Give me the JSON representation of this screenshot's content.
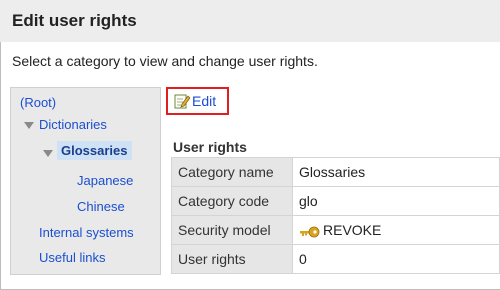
{
  "page": {
    "title": "Edit user rights",
    "description": "Select a category to view and change user rights."
  },
  "tree": {
    "root": "(Root)",
    "dictionaries": "Dictionaries",
    "glossaries": "Glossaries",
    "japanese": "Japanese",
    "chinese": "Chinese",
    "internal_systems": "Internal systems",
    "useful_links": "Useful links"
  },
  "toolbar": {
    "edit_label": "Edit",
    "edit_icon": "edit-icon"
  },
  "user_rights": {
    "section_title": "User rights",
    "rows": [
      {
        "label": "Category name",
        "value": "Glossaries"
      },
      {
        "label": "Category code",
        "value": "glo"
      },
      {
        "label": "Security model",
        "value": "REVOKE",
        "icon": "key-icon"
      },
      {
        "label": "User rights",
        "value": "0"
      }
    ]
  },
  "colors": {
    "link": "#1a4fd0",
    "highlight_border": "#e02020",
    "selected_bg": "#cfe1f5",
    "key": "#d9a520"
  }
}
